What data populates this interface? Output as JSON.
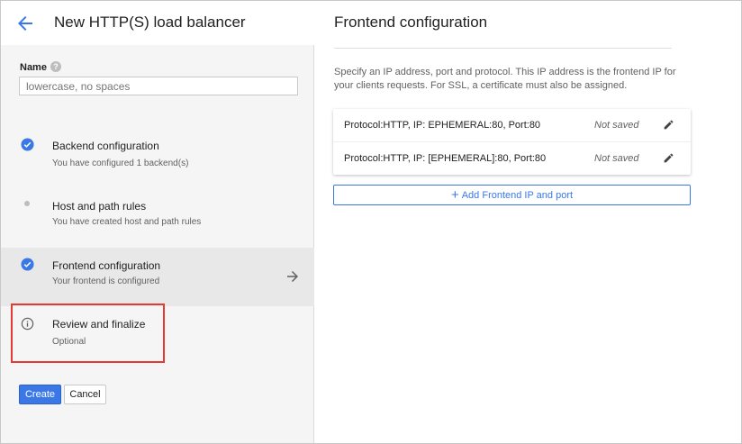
{
  "header": {
    "back_icon": "arrow-back-icon",
    "title": "New HTTP(S) load balancer"
  },
  "name_field": {
    "label": "Name",
    "help_icon": "help-icon",
    "help_glyph": "?",
    "value": "",
    "placeholder": "lowercase, no spaces"
  },
  "steps": [
    {
      "title": "Backend configuration",
      "subtitle": "You have configured 1 backend(s)",
      "state": "complete",
      "icon": "check-circle-icon"
    },
    {
      "title": "Host and path rules",
      "subtitle": "You have created host and path rules",
      "state": "pending",
      "icon": "dot-icon"
    },
    {
      "title": "Frontend configuration",
      "subtitle": "Your frontend is configured",
      "state": "complete-active",
      "icon": "check-circle-icon"
    },
    {
      "title": "Review and finalize",
      "subtitle": "Optional",
      "state": "optional",
      "icon": "info-icon"
    }
  ],
  "actions": {
    "create_label": "Create",
    "cancel_label": "Cancel"
  },
  "frontend": {
    "title": "Frontend configuration",
    "description": "Specify an IP address, port and protocol. This IP address is the frontend IP for your clients requests. For SSL, a certificate must also be assigned.",
    "entries": [
      {
        "text": "Protocol:HTTP, IP: EPHEMERAL:80, Port:80",
        "status": "Not saved"
      },
      {
        "text": "Protocol:HTTP, IP: [EPHEMERAL]:80, Port:80",
        "status": "Not saved"
      }
    ],
    "add_label": "Add Frontend IP and port",
    "add_glyph": "+"
  },
  "colors": {
    "accent": "#3b78e7",
    "highlight": "#e53935",
    "panel_bg": "#f5f5f5",
    "active_step_bg": "#e8e8e8"
  }
}
